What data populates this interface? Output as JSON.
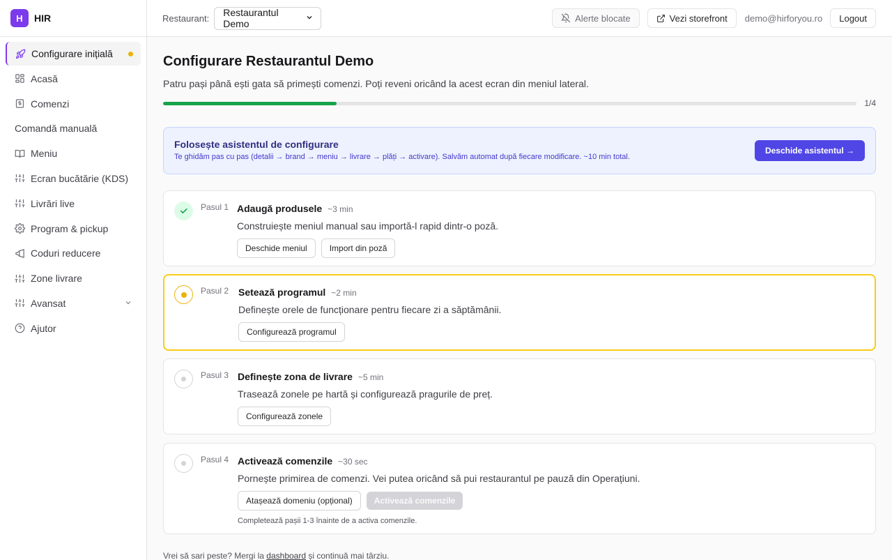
{
  "brand": {
    "logo_letter": "H",
    "name": "HIR"
  },
  "sidebar": {
    "items": [
      {
        "label": "Configurare inițială",
        "icon": "rocket-icon",
        "active": true,
        "badge": true
      },
      {
        "label": "Acasă",
        "icon": "grid-icon"
      },
      {
        "label": "Comenzi",
        "icon": "receipt-icon"
      },
      {
        "label": "Comandă manuală",
        "icon": ""
      },
      {
        "label": "Meniu",
        "icon": "book-icon"
      },
      {
        "label": "Ecran bucătărie (KDS)",
        "icon": "sliders-icon"
      },
      {
        "label": "Livrări live",
        "icon": "sliders-icon"
      },
      {
        "label": "Program & pickup",
        "icon": "gear-icon"
      },
      {
        "label": "Coduri reducere",
        "icon": "megaphone-icon"
      },
      {
        "label": "Zone livrare",
        "icon": "sliders-icon"
      },
      {
        "label": "Avansat",
        "icon": "sliders-icon",
        "expandable": true
      },
      {
        "label": "Ajutor",
        "icon": "help-icon"
      }
    ]
  },
  "topbar": {
    "restaurant_label": "Restaurant:",
    "restaurant_selected": "Restaurantul Demo",
    "alerts_label": "Alerte blocate",
    "storefront_label": "Vezi storefront",
    "user_email": "demo@hirforyou.ro",
    "logout_label": "Logout"
  },
  "main": {
    "title": "Configurare Restaurantul Demo",
    "subtitle": "Patru pași până ești gata să primești comenzi. Poți reveni oricând la acest ecran din meniul lateral.",
    "progress": {
      "completed": 1,
      "total": 4,
      "label": "1/4"
    },
    "assistant": {
      "title": "Folosește asistentul de configurare",
      "description": "Te ghidăm pas cu pas (detalii → brand → meniu → livrare → plăți → activare). Salvăm automat după fiecare modificare. ~10 min total.",
      "button": "Deschide asistentul →"
    },
    "steps": [
      {
        "num": "Pasul 1",
        "title": "Adaugă produsele",
        "time": "~3 min",
        "desc": "Construiește meniul manual sau importă-l rapid dintr-o poză.",
        "status": "done",
        "actions": [
          "Deschide meniul",
          "Import din poză"
        ]
      },
      {
        "num": "Pasul 2",
        "title": "Setează programul",
        "time": "~2 min",
        "desc": "Definește orele de funcționare pentru fiecare zi a săptămânii.",
        "status": "current",
        "actions": [
          "Configurează programul"
        ]
      },
      {
        "num": "Pasul 3",
        "title": "Definește zona de livrare",
        "time": "~5 min",
        "desc": "Trasează zonele pe hartă și configurează pragurile de preț.",
        "status": "todo",
        "actions": [
          "Configurează zonele"
        ]
      },
      {
        "num": "Pasul 4",
        "title": "Activează comenzile",
        "time": "~30 sec",
        "desc": "Pornește primirea de comenzi. Vei putea oricând să pui restaurantul pe pauză din Operațiuni.",
        "status": "todo",
        "actions": [
          "Atașează domeniu (opțional)"
        ],
        "disabled_action": "Activează comenzile",
        "note": "Completează pașii 1-3 înainte de a activa comenzile."
      }
    ],
    "footer": {
      "before": "Vrei să sari peste? Mergi la ",
      "link": "dashboard",
      "after": " și continuă mai târziu."
    }
  },
  "colors": {
    "accent": "#7c3aed",
    "progress": "#16a34a",
    "current_step": "#facc15",
    "assistant_button": "#4f46e5"
  }
}
